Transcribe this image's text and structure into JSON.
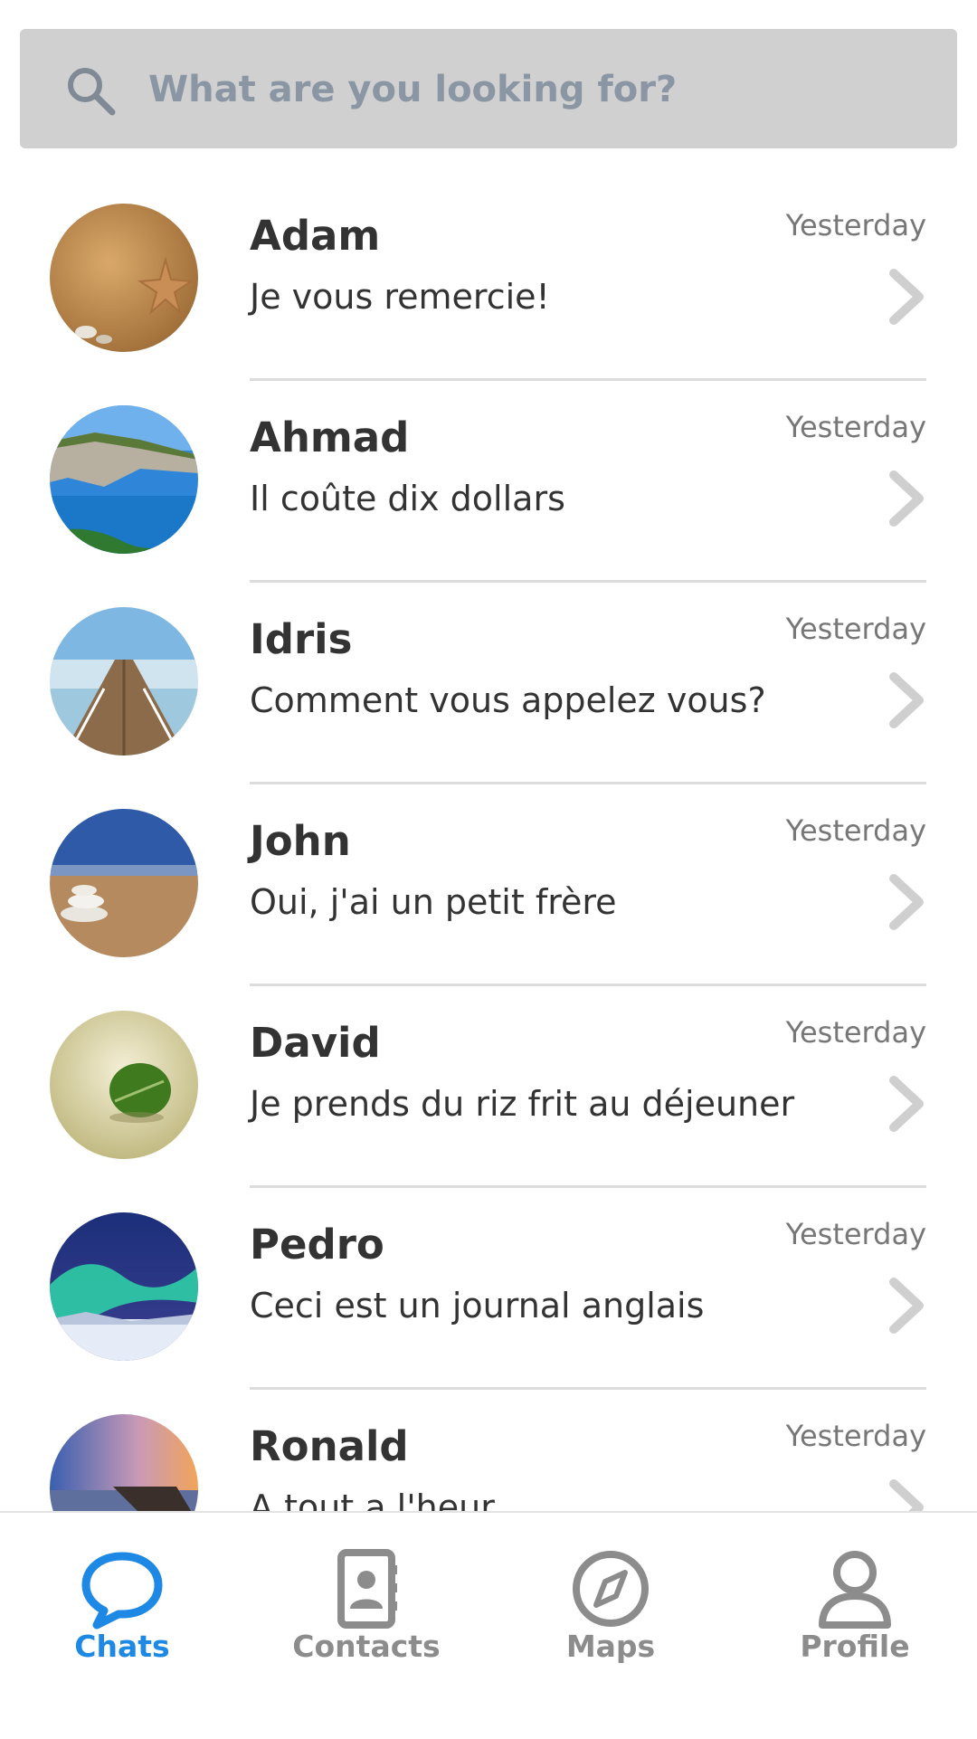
{
  "search": {
    "placeholder": "What are you looking for?"
  },
  "chats": [
    {
      "name": "Adam",
      "message": "Je vous remercie!",
      "time": "Yesterday"
    },
    {
      "name": "Ahmad",
      "message": "Il coûte dix dollars",
      "time": "Yesterday"
    },
    {
      "name": "Idris",
      "message": "Comment vous appelez vous?",
      "time": "Yesterday"
    },
    {
      "name": "John",
      "message": "Oui, j'ai un petit frère",
      "time": "Yesterday"
    },
    {
      "name": "David",
      "message": "Je prends du riz frit au déjeuner",
      "time": "Yesterday"
    },
    {
      "name": "Pedro",
      "message": "Ceci est un journal anglais",
      "time": "Yesterday"
    },
    {
      "name": "Ronald",
      "message": "A tout a l'heur",
      "time": "Yesterday"
    }
  ],
  "tabs": [
    {
      "label": "Chats",
      "icon": "chat-bubble-icon",
      "active": true
    },
    {
      "label": "Contacts",
      "icon": "contacts-book-icon",
      "active": false
    },
    {
      "label": "Maps",
      "icon": "compass-icon",
      "active": false
    },
    {
      "label": "Profile",
      "icon": "person-icon",
      "active": false
    }
  ],
  "colors": {
    "accent": "#1e88e5",
    "inactive": "#8c8c8c",
    "search_bg": "#d0d0d0"
  }
}
